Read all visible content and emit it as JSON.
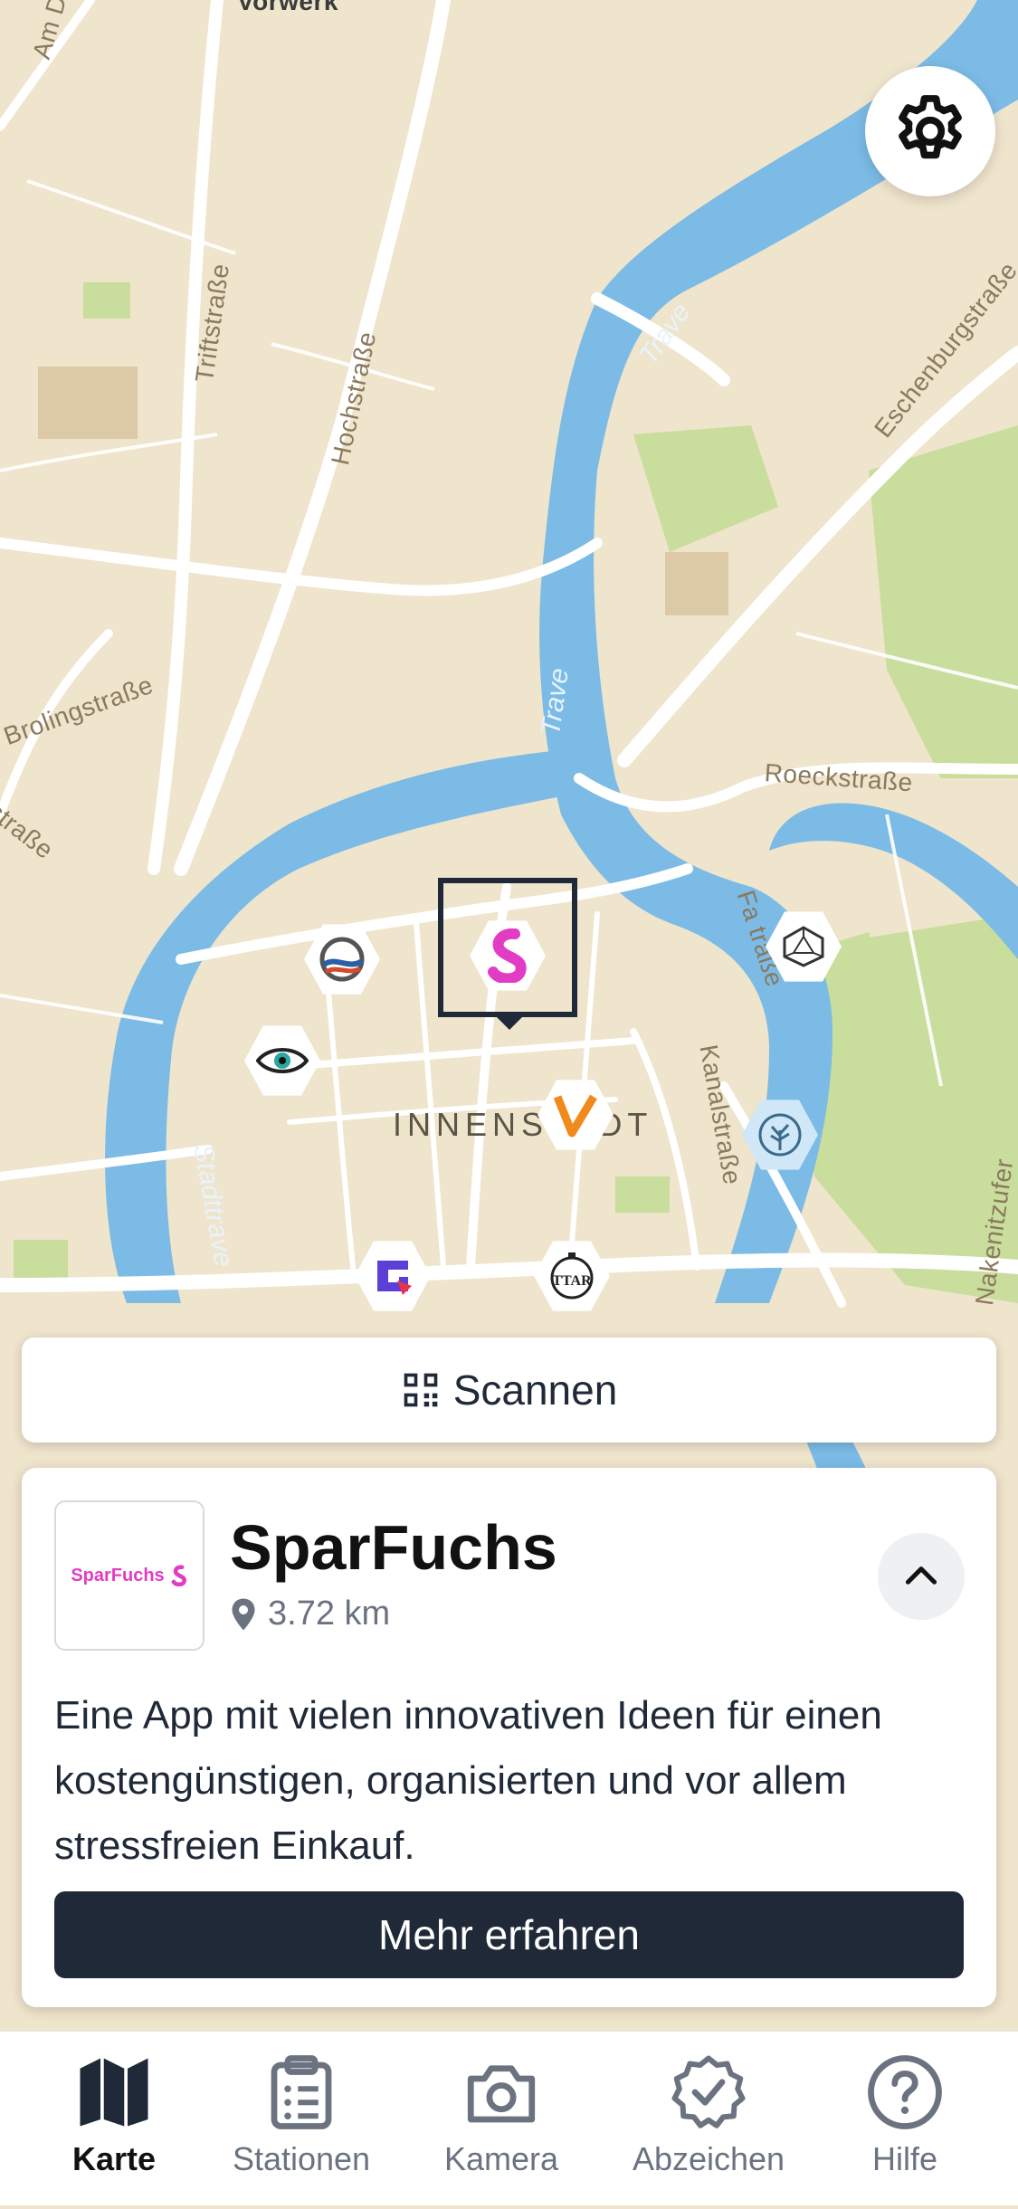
{
  "map": {
    "labels": {
      "vorwerk": "Vorwerk",
      "am_dreworp": "Am Dreworp",
      "triftstrasse": "Triftstraße",
      "hochstrasse": "Hochstraße",
      "eschenburgstrasse": "Eschenburgstraße",
      "brolingstrasse": "Brolingstraße",
      "strasse_left": "straße",
      "roeckstrasse": "Roeckstraße",
      "trave_top": "Trave",
      "trave_mid": "Trave",
      "stadttrave": "Stadttrave",
      "kanalstrasse": "Kanalstraße",
      "fackenburger": "Fa     traße",
      "nakenitzufer": "Nakenitzufer",
      "district": "INNENSTADT"
    },
    "stations": [
      {
        "name": "Schiff",
        "icon": "ship-swirl-icon"
      },
      {
        "name": "Auge",
        "icon": "eye-icon"
      },
      {
        "name": "SparFuchs",
        "icon": "sparfuchs-s-icon",
        "selected": true
      },
      {
        "name": "V",
        "icon": "v-logo-icon"
      },
      {
        "name": "Geometrie",
        "icon": "polyhedron-icon"
      },
      {
        "name": "Baum",
        "icon": "tree-icon"
      },
      {
        "name": "G",
        "icon": "g-logo-icon"
      },
      {
        "name": "TTAR",
        "icon": "stopwatch-icon",
        "text": "TTAR"
      }
    ]
  },
  "settings": {
    "icon": "gear-icon"
  },
  "scan_button": {
    "label": "Scannen",
    "icon": "qr-code-icon"
  },
  "card": {
    "logo_text": "SparFuchs",
    "title": "SparFuchs",
    "distance": "3.72 km",
    "description": "Eine App mit vielen innovativen Ideen für einen kostengünstigen, organisierten und vor allem stressfreien Einkauf.",
    "more_button": "Mehr erfahren"
  },
  "tabs": [
    {
      "label": "Karte",
      "icon": "map-icon",
      "active": true
    },
    {
      "label": "Stationen",
      "icon": "clipboard-list-icon"
    },
    {
      "label": "Kamera",
      "icon": "camera-icon"
    },
    {
      "label": "Abzeichen",
      "icon": "badge-check-icon"
    },
    {
      "label": "Hilfe",
      "icon": "help-circle-icon"
    }
  ],
  "colors": {
    "water": "#7bbbe6",
    "park": "#c9dd9c",
    "land": "#efe4cc",
    "road": "#ffffff",
    "accent_dark": "#1f2937",
    "brand_pink": "#e23cc5"
  }
}
